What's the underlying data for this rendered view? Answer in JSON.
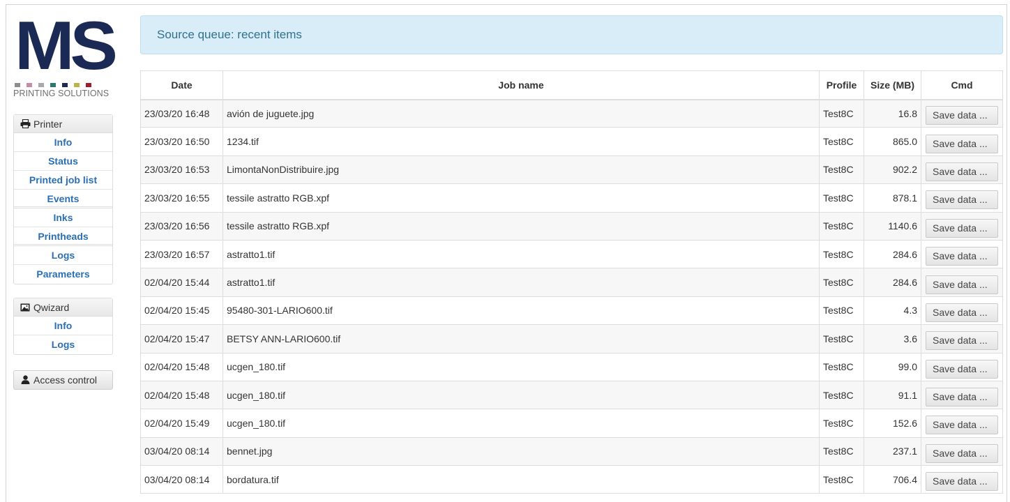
{
  "logo": {
    "text": "MS",
    "subtitle": "PRINTING SOLUTIONS",
    "dot_colors": [
      "#8b8d90",
      "#c58da3",
      "#a7a9ac",
      "#2c7a6c",
      "#1b2a55",
      "#b9b34a",
      "#9e1d2d"
    ]
  },
  "sidebar": {
    "printer": {
      "title": "Printer",
      "items": [
        "Info",
        "Status",
        "Printed job list",
        "Events",
        "Inks",
        "Printheads",
        "Logs",
        "Parameters"
      ]
    },
    "qwizard": {
      "title": "Qwizard",
      "items": [
        "Info",
        "Logs"
      ]
    },
    "access_label": "Access control"
  },
  "main": {
    "alert_text": "Source queue: recent items",
    "table": {
      "headers": [
        "Date",
        "Job name",
        "Profile",
        "Size (MB)",
        "Cmd"
      ],
      "rows": [
        {
          "date": "23/03/20 16:48",
          "name": "avión de juguete.jpg",
          "profile": "Test8C",
          "size": "16.8",
          "cmd": "Save data ..."
        },
        {
          "date": "23/03/20 16:50",
          "name": "1234.tif",
          "profile": "Test8C",
          "size": "865.0",
          "cmd": "Save data ..."
        },
        {
          "date": "23/03/20 16:53",
          "name": "LimontaNonDistribuire.jpg",
          "profile": "Test8C",
          "size": "902.2",
          "cmd": "Save data ..."
        },
        {
          "date": "23/03/20 16:55",
          "name": "tessile astratto RGB.xpf",
          "profile": "Test8C",
          "size": "878.1",
          "cmd": "Save data ..."
        },
        {
          "date": "23/03/20 16:56",
          "name": "tessile astratto RGB.xpf",
          "profile": "Test8C",
          "size": "1140.6",
          "cmd": "Save data ..."
        },
        {
          "date": "23/03/20 16:57",
          "name": "astratto1.tif",
          "profile": "Test8C",
          "size": "284.6",
          "cmd": "Save data ..."
        },
        {
          "date": "02/04/20 15:44",
          "name": "astratto1.tif",
          "profile": "Test8C",
          "size": "284.6",
          "cmd": "Save data ..."
        },
        {
          "date": "02/04/20 15:45",
          "name": "95480-301-LARIO600.tif",
          "profile": "Test8C",
          "size": "4.3",
          "cmd": "Save data ..."
        },
        {
          "date": "02/04/20 15:47",
          "name": "BETSY ANN-LARIO600.tif",
          "profile": "Test8C",
          "size": "3.6",
          "cmd": "Save data ..."
        },
        {
          "date": "02/04/20 15:48",
          "name": "ucgen_180.tif",
          "profile": "Test8C",
          "size": "99.0",
          "cmd": "Save data ..."
        },
        {
          "date": "02/04/20 15:48",
          "name": "ucgen_180.tif",
          "profile": "Test8C",
          "size": "91.1",
          "cmd": "Save data ..."
        },
        {
          "date": "02/04/20 15:49",
          "name": "ucgen_180.tif",
          "profile": "Test8C",
          "size": "152.6",
          "cmd": "Save data ..."
        },
        {
          "date": "03/04/20 08:14",
          "name": "bennet.jpg",
          "profile": "Test8C",
          "size": "237.1",
          "cmd": "Save data ..."
        },
        {
          "date": "03/04/20 08:14",
          "name": "bordatura.tif",
          "profile": "Test8C",
          "size": "706.4",
          "cmd": "Save data ..."
        }
      ]
    }
  }
}
